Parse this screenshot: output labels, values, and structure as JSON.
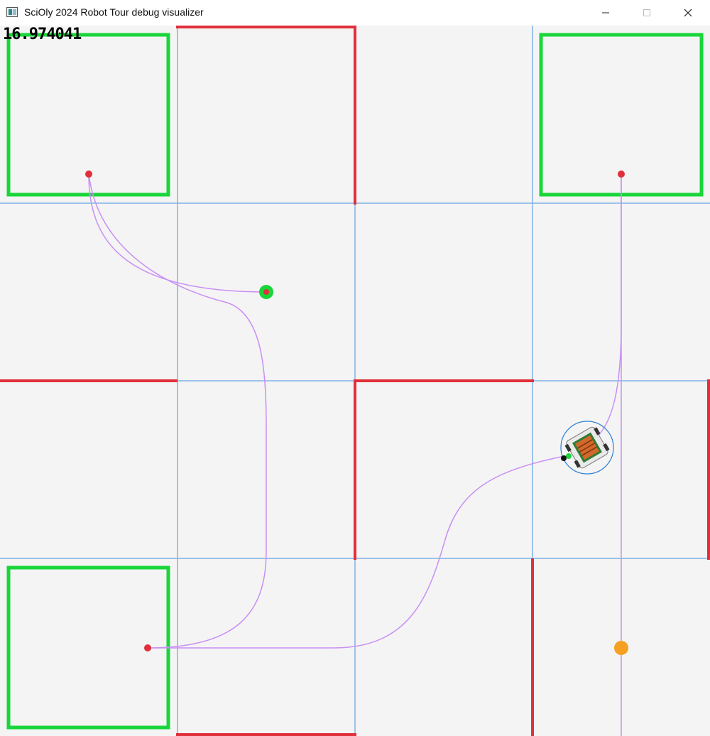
{
  "window": {
    "title": "SciOly 2024 Robot Tour debug visualizer",
    "minimize_icon": "minimize-icon",
    "maximize_icon": "maximize-icon",
    "close_icon": "close-icon"
  },
  "canvas": {
    "timer": "16.974041",
    "colors": {
      "grid": "#7fb2e5",
      "wall": "#e0303a",
      "zone": "#18d63a",
      "path": "#c98ff5",
      "waypoint": "#e0303a",
      "target": "#f5a020",
      "robot_ring": "#2a7fd4"
    }
  }
}
